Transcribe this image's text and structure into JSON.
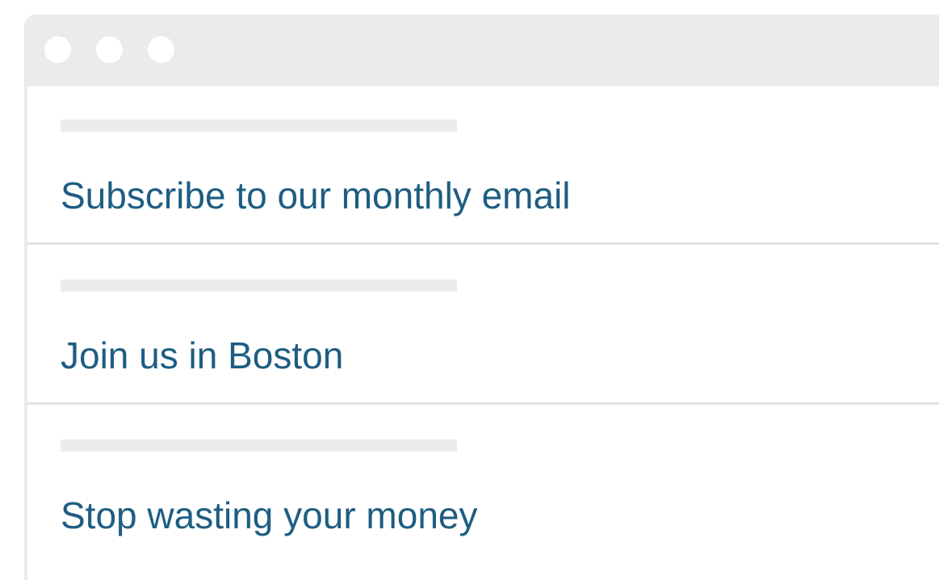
{
  "window": {
    "titlebar_dots": [
      "window-dot",
      "window-dot",
      "window-dot"
    ]
  },
  "list": {
    "items": [
      {
        "label": "Subscribe to our monthly email"
      },
      {
        "label": "Join us in Boston"
      },
      {
        "label": "Stop wasting your money"
      }
    ]
  },
  "colors": {
    "link": "#1e5d82",
    "chrome": "#ebebed",
    "divider": "#e3e3e5"
  }
}
